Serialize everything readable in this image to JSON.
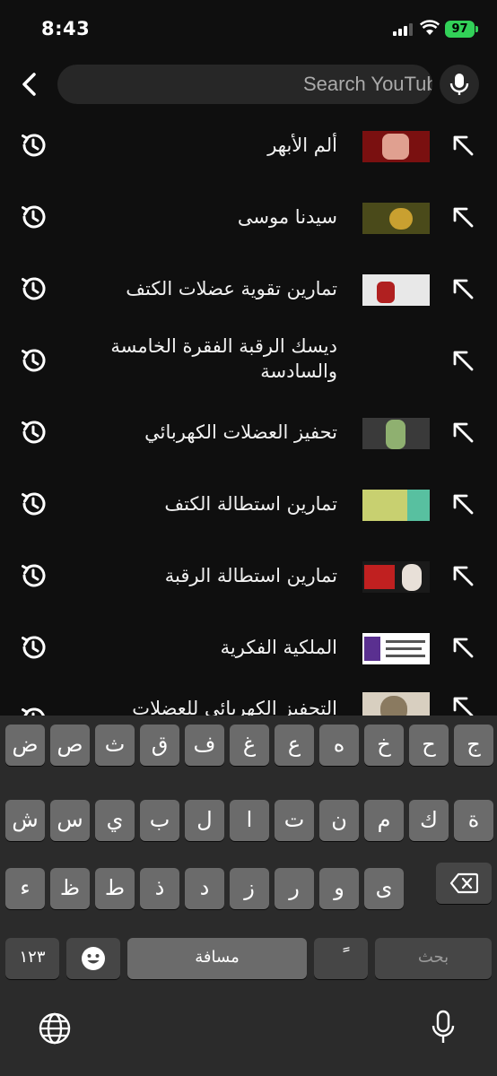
{
  "status_bar": {
    "time": "8:43",
    "battery": "97"
  },
  "header": {
    "search_placeholder": "Search YouTube"
  },
  "suggestions": [
    {
      "text": "ألم الأبهر",
      "thumb": [
        "#7a1010",
        "#e0e0e0"
      ]
    },
    {
      "text": "سيدنا موسى",
      "thumb": [
        "#4a4a1a",
        "#c9a030"
      ]
    },
    {
      "text": "تمارين تقوية عضلات الكتف",
      "thumb": [
        "#e8e8e8",
        "#b02020"
      ]
    },
    {
      "text": "ديسك الرقبة الفقرة الخامسة والسادسة",
      "thumb": null
    },
    {
      "text": "تحفيز العضلات الكهربائي",
      "thumb": [
        "#3a3a3a",
        "#8fb070"
      ]
    },
    {
      "text": "تمارين استطالة الكتف",
      "thumb": [
        "#c8d070",
        "#58c0a0"
      ]
    },
    {
      "text": "تمارين استطالة الرقبة",
      "thumb": [
        "#1a1a1a",
        "#c02020"
      ]
    },
    {
      "text": "الملكية الفكرية",
      "thumb": [
        "#ffffff",
        "#5a3090"
      ]
    },
    {
      "text": "التحفيز الكهربائي للعضلات",
      "thumb": [
        "#d8cfc0",
        "#8a7a60"
      ]
    }
  ],
  "keyboard": {
    "row1": [
      "ض",
      "ص",
      "ث",
      "ق",
      "ف",
      "غ",
      "ع",
      "ه",
      "خ",
      "ح",
      "ج"
    ],
    "row2": [
      "ش",
      "س",
      "ي",
      "ب",
      "ل",
      "ا",
      "ت",
      "ن",
      "م",
      "ك",
      "ة"
    ],
    "row3": [
      "ء",
      "ظ",
      "ط",
      "ذ",
      "د",
      "ز",
      "ر",
      "و",
      "ى"
    ],
    "numbers_label": "١٢٣",
    "space_label": "مسافة",
    "tanween_label": "ً",
    "return_label": "بحث"
  }
}
